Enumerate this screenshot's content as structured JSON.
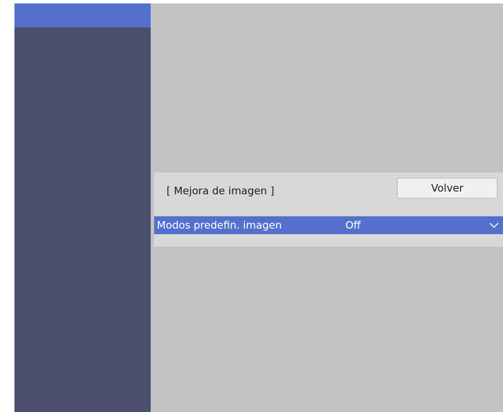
{
  "sidebar": {
    "items": [
      {
        "label": "",
        "selected": true
      }
    ]
  },
  "panel": {
    "title": "[ Mejora de imagen ]",
    "back_label": "Volver",
    "rows": [
      {
        "label": "Modos predefin. imagen",
        "value": "Off",
        "selected": true
      }
    ]
  },
  "colors": {
    "sidebar": "#4b4f6b",
    "accent": "#5470cc",
    "background": "#c3c3c3",
    "panel": "#d8d8d8"
  },
  "icons": {
    "dropdown": "chevron-down-icon"
  }
}
